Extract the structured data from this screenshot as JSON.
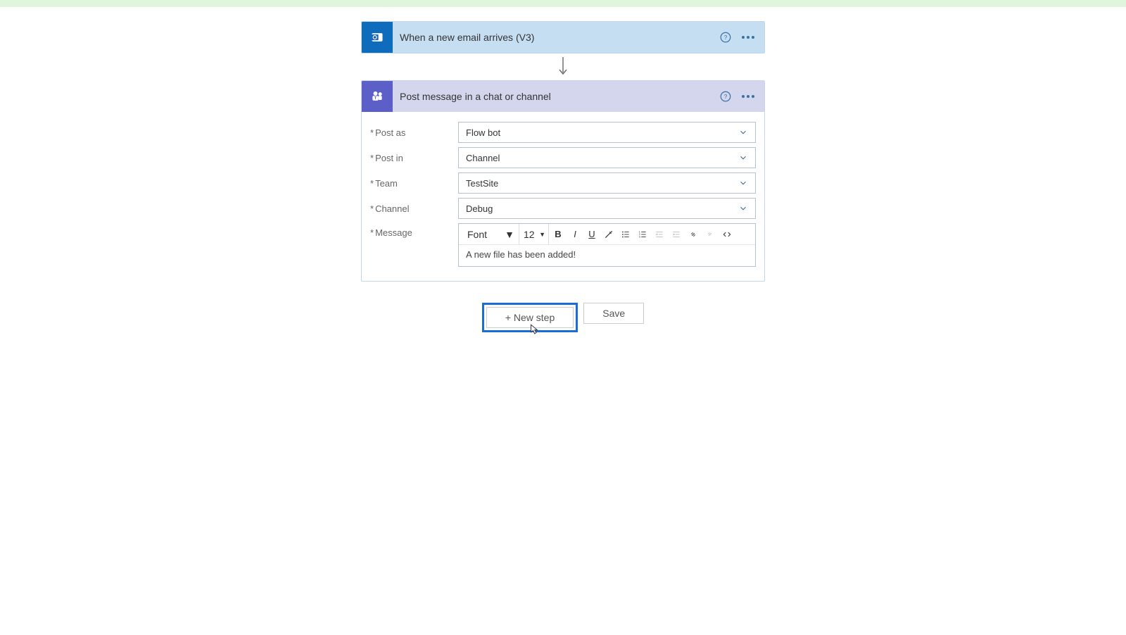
{
  "trigger": {
    "title": "When a new email arrives (V3)"
  },
  "action": {
    "title": "Post message in a chat or channel",
    "fields": {
      "postAsLabel": "Post as",
      "postAsValue": "Flow bot",
      "postInLabel": "Post in",
      "postInValue": "Channel",
      "teamLabel": "Team",
      "teamValue": "TestSite",
      "channelLabel": "Channel",
      "channelValue": "Debug",
      "messageLabel": "Message",
      "fontLabel": "Font",
      "fontSize": "12",
      "messageContent": "A new file has been added!"
    }
  },
  "footer": {
    "newStep": "+ New step",
    "save": "Save"
  },
  "required": "*"
}
